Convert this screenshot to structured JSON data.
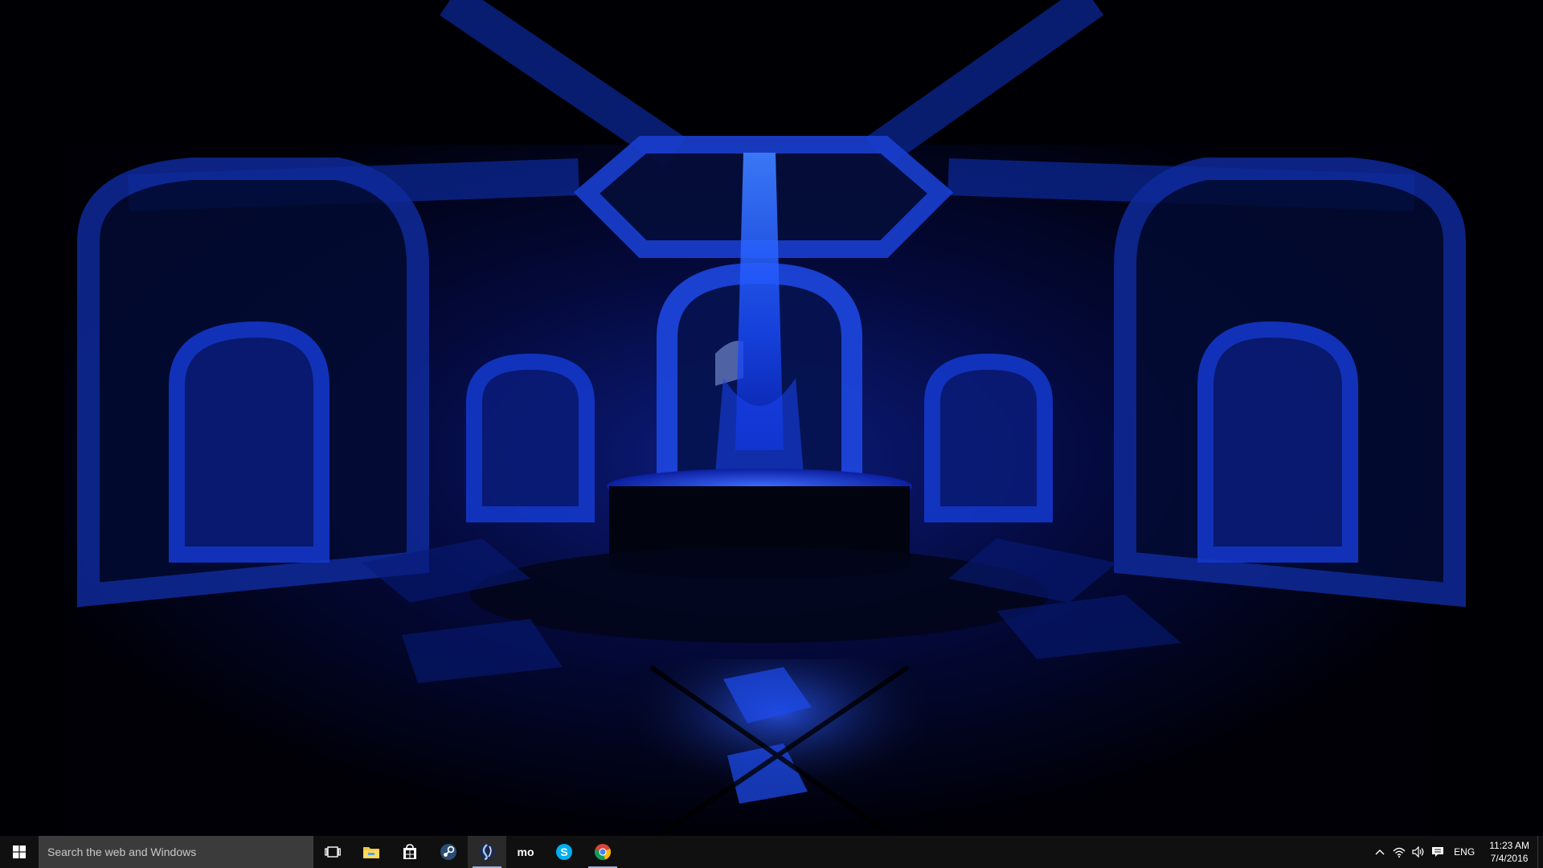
{
  "desktop": {
    "wallpaper": "dark blue dungeon chamber with glowing fountain",
    "colors": {
      "glow": "#1e5bff",
      "stone": "#0a1a66",
      "deep": "#000010"
    }
  },
  "taskbar": {
    "start_icon": "windows-logo-icon",
    "search": {
      "placeholder": "Search the web and Windows"
    },
    "apps": [
      {
        "name": "task-view",
        "icon": "task-view-icon"
      },
      {
        "name": "file-explorer",
        "icon": "folder-icon"
      },
      {
        "name": "store",
        "icon": "store-bag-icon"
      },
      {
        "name": "steam",
        "icon": "steam-icon"
      },
      {
        "name": "app-swirl",
        "icon": "swirl-app-icon",
        "running": true
      },
      {
        "name": "mo",
        "icon": "mo-app-icon",
        "label": "mo"
      },
      {
        "name": "skype",
        "icon": "skype-icon",
        "label": "S"
      },
      {
        "name": "chrome",
        "icon": "chrome-icon",
        "running": true
      }
    ],
    "tray": {
      "icons": [
        "chevron-up-icon",
        "network-icon",
        "volume-icon",
        "action-center-icon"
      ],
      "language": "ENG",
      "time": "11:23 AM",
      "date": "7/4/2016"
    },
    "colors": {
      "background": "#101010",
      "search_bg": "#3b3b3b",
      "running_indicator": "#9ab0d6"
    }
  }
}
